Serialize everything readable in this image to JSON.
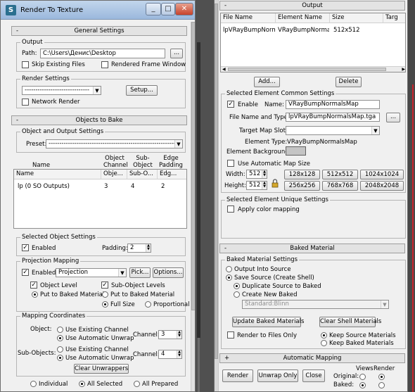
{
  "left_window": {
    "title": "Render To Texture",
    "caption_buttons": [
      "_",
      "□",
      "✕"
    ],
    "general_settings": {
      "header": "General Settings",
      "output_group": "Output",
      "path_label": "Path:",
      "path_value": "C:\\Users\\Денис\\Desktop",
      "browse_label": "...",
      "skip_existing": "Skip Existing Files",
      "rendered_frame_window": "Rendered Frame Window",
      "render_settings_group": "Render Settings",
      "render_settings_value": "------------------------------",
      "setup_label": "Setup...",
      "network_render": "Network Render"
    },
    "objects_to_bake": {
      "header": "Objects to Bake",
      "object_output_group": "Object and Output Settings",
      "preset_label": "Preset:",
      "preset_value": "----------------------------------------------------------------",
      "col_name": "Name",
      "col_object_channel": "Object Channel",
      "col_subobject_channel": "Sub-Object Channel",
      "col_edge_padding": "Edge Padding",
      "table_headers": [
        "Name",
        "Obje...",
        "Sub-O...",
        "Edg..."
      ],
      "rows": [
        {
          "name": "lp (0 SO Outputs)",
          "object": "3",
          "subobject": "4",
          "edge": "2"
        }
      ]
    },
    "selected_object": {
      "group": "Selected Object Settings",
      "enabled": "Enabled",
      "padding_label": "Padding:",
      "padding_value": "2"
    },
    "projection": {
      "group": "Projection Mapping",
      "enabled": "Enabled",
      "type_value": "Projection",
      "pick_label": "Pick...",
      "options_label": "Options...",
      "object_level": "Object Level",
      "subobject_levels": "Sub-Object Levels",
      "put_baked_1": "Put to Baked Material",
      "put_baked_2": "Put to Baked Material",
      "full_size": "Full Size",
      "proportional": "Proportional"
    },
    "mapping": {
      "group": "Mapping Coordinates",
      "object_label": "Object:",
      "use_existing_1": "Use Existing Channel",
      "use_auto_1": "Use Automatic Unwrap",
      "channel_label_1": "Channel:",
      "channel_value_1": "3",
      "subobjects_label": "Sub-Objects:",
      "use_existing_2": "Use Existing Channel",
      "use_auto_2": "Use Automatic Unwrap",
      "channel_label_2": "Channel:",
      "channel_value_2": "4",
      "clear_unwrappers": "Clear Unwrappers"
    },
    "bottom_options": [
      "Individual",
      "All Selected",
      "All Prepared"
    ]
  },
  "right_window": {
    "output_header": "Output",
    "table_headers": [
      "File Name",
      "Element Name",
      "Size",
      "Targ"
    ],
    "rows": [
      {
        "file": "lpVRayBumpNorma...",
        "element": "VRayBumpNormals",
        "size": "512x512"
      }
    ],
    "add_label": "Add...",
    "delete_label": "Delete",
    "common": {
      "group": "Selected Element Common Settings",
      "enable": "Enable",
      "name_label": "Name:",
      "name_value": "VRayBumpNormalsMap",
      "file_type_label": "File Name and Type:",
      "file_type_value": "lpVRayBumpNormalsMap.tga",
      "browse_label": "...",
      "target_slot_label": "Target Map Slot:",
      "element_type_label": "Element Type:",
      "element_type_value": "VRayBumpNormalsMap",
      "element_bg_label": "Element Background:",
      "auto_map_size": "Use Automatic Map Size",
      "width_label": "Width:",
      "width_value": "512",
      "height_label": "Height:",
      "height_value": "512",
      "sizes": [
        "128x128",
        "512x512",
        "1024x1024",
        "256x256",
        "768x768",
        "2048x2048"
      ]
    },
    "unique": {
      "group": "Selected Element Unique Settings",
      "apply_color": "Apply color mapping"
    },
    "baked_header": "Baked Material",
    "baked": {
      "group": "Baked Material Settings",
      "output_into_source": "Output Into Source",
      "save_source": "Save Source (Create Shell)",
      "duplicate_source": "Duplicate Source to Baked",
      "create_new_baked": "Create New Baked",
      "material_value": "Standard:Blinn",
      "update_baked": "Update Baked Materials",
      "clear_shell": "Clear Shell Materials",
      "render_files_only": "Render to Files Only",
      "keep_source": "Keep Source Materials",
      "keep_baked": "Keep Baked Materials"
    },
    "auto_mapping_header": "Automatic Mapping",
    "footer": {
      "render": "Render",
      "unwrap_only": "Unwrap Only",
      "close": "Close",
      "original_label": "Original:",
      "baked_label": "Baked:",
      "views_label": "Views",
      "render_label": "Render"
    }
  }
}
